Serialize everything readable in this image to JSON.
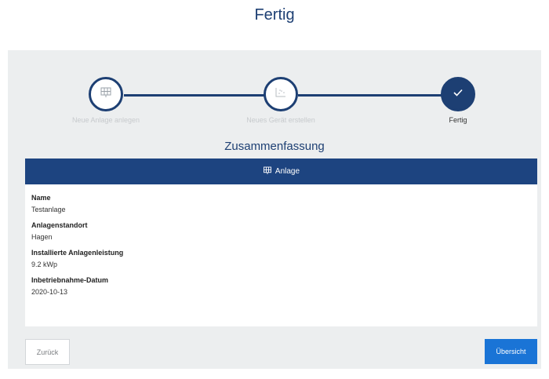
{
  "page": {
    "title": "Fertig"
  },
  "stepper": {
    "steps": [
      {
        "label": "Neue Anlage anlegen",
        "icon": "solar-panel-icon",
        "state": "completed"
      },
      {
        "label": "Neues Gerät erstellen",
        "icon": "chart-icon",
        "state": "completed"
      },
      {
        "label": "Fertig",
        "icon": "checkmark-icon",
        "state": "active"
      }
    ]
  },
  "summary": {
    "title": "Zusammenfassung",
    "card_title": "Anlage",
    "fields": [
      {
        "label": "Name",
        "value": "Testanlage"
      },
      {
        "label": "Anlagenstandort",
        "value": "Hagen"
      },
      {
        "label": "Installierte Anlagenleistung",
        "value": "9.2 kWp"
      },
      {
        "label": "Inbetriebnahme-Datum",
        "value": "2020-10-13"
      }
    ]
  },
  "buttons": {
    "back": "Zurück",
    "overview": "Übersicht"
  },
  "colors": {
    "primary": "#1d3f73",
    "header": "#1d4480",
    "accent": "#1a74d6",
    "panel": "#eceeef"
  }
}
